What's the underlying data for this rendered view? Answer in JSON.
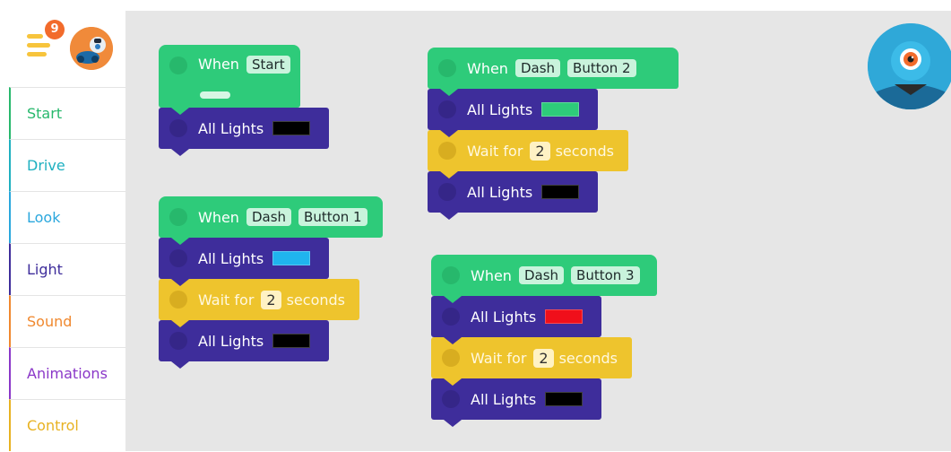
{
  "sidebar": {
    "notification_count": "9",
    "categories": [
      {
        "label": "Start",
        "color": "#27b86c"
      },
      {
        "label": "Drive",
        "color": "#1eb0c0"
      },
      {
        "label": "Look",
        "color": "#2aa7dd"
      },
      {
        "label": "Light",
        "color": "#3e2d9b"
      },
      {
        "label": "Sound",
        "color": "#f0882e"
      },
      {
        "label": "Animations",
        "color": "#8a37c8"
      },
      {
        "label": "Control",
        "color": "#e8b221"
      }
    ]
  },
  "blocks": {
    "when_label": "When",
    "start_label": "Start",
    "dash_label": "Dash",
    "all_lights_label": "All Lights",
    "wait_for_label": "Wait for",
    "seconds_label": "seconds",
    "button1_label": "Button 1",
    "button2_label": "Button 2",
    "button3_label": "Button 3",
    "wait_value": "2"
  },
  "colors": {
    "event_block": "#2ecb7a",
    "light_block": "#3e2d9b",
    "control_block": "#eec42d",
    "canvas_bg": "#e6e6e6",
    "swatch_off": "#000000",
    "swatch_green": "#2ecb7a",
    "swatch_blue": "#1fb4ee",
    "swatch_red": "#f00f1a"
  }
}
